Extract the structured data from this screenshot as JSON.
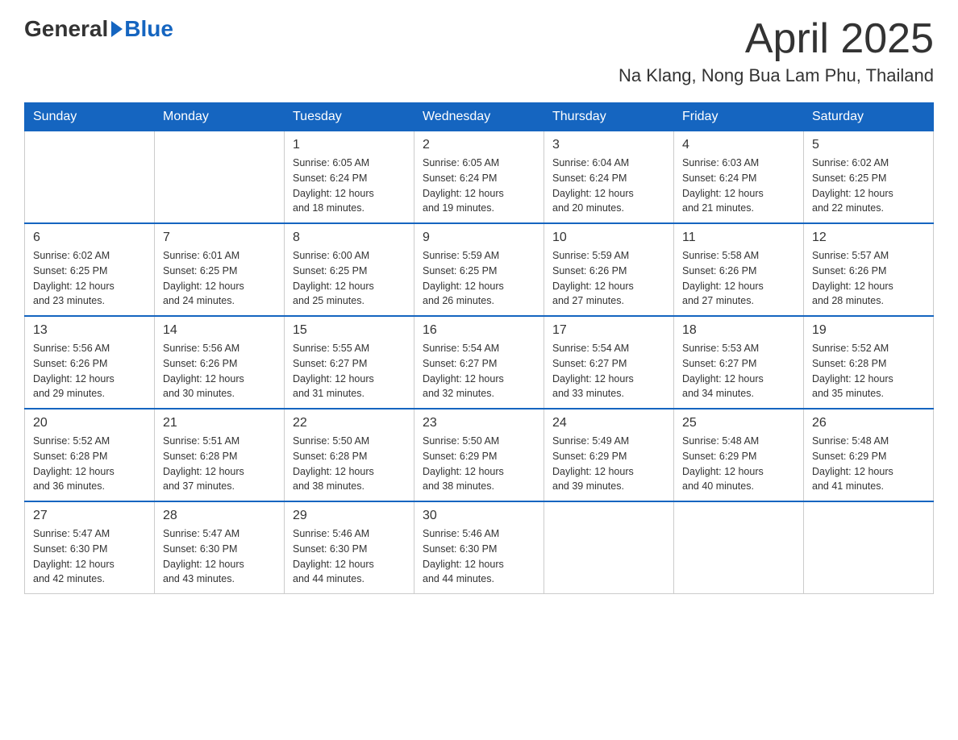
{
  "header": {
    "logo_general": "General",
    "logo_blue": "Blue",
    "title": "April 2025",
    "subtitle": "Na Klang, Nong Bua Lam Phu, Thailand"
  },
  "weekdays": [
    "Sunday",
    "Monday",
    "Tuesday",
    "Wednesday",
    "Thursday",
    "Friday",
    "Saturday"
  ],
  "weeks": [
    [
      {
        "day": "",
        "info": ""
      },
      {
        "day": "",
        "info": ""
      },
      {
        "day": "1",
        "info": "Sunrise: 6:05 AM\nSunset: 6:24 PM\nDaylight: 12 hours\nand 18 minutes."
      },
      {
        "day": "2",
        "info": "Sunrise: 6:05 AM\nSunset: 6:24 PM\nDaylight: 12 hours\nand 19 minutes."
      },
      {
        "day": "3",
        "info": "Sunrise: 6:04 AM\nSunset: 6:24 PM\nDaylight: 12 hours\nand 20 minutes."
      },
      {
        "day": "4",
        "info": "Sunrise: 6:03 AM\nSunset: 6:24 PM\nDaylight: 12 hours\nand 21 minutes."
      },
      {
        "day": "5",
        "info": "Sunrise: 6:02 AM\nSunset: 6:25 PM\nDaylight: 12 hours\nand 22 minutes."
      }
    ],
    [
      {
        "day": "6",
        "info": "Sunrise: 6:02 AM\nSunset: 6:25 PM\nDaylight: 12 hours\nand 23 minutes."
      },
      {
        "day": "7",
        "info": "Sunrise: 6:01 AM\nSunset: 6:25 PM\nDaylight: 12 hours\nand 24 minutes."
      },
      {
        "day": "8",
        "info": "Sunrise: 6:00 AM\nSunset: 6:25 PM\nDaylight: 12 hours\nand 25 minutes."
      },
      {
        "day": "9",
        "info": "Sunrise: 5:59 AM\nSunset: 6:25 PM\nDaylight: 12 hours\nand 26 minutes."
      },
      {
        "day": "10",
        "info": "Sunrise: 5:59 AM\nSunset: 6:26 PM\nDaylight: 12 hours\nand 27 minutes."
      },
      {
        "day": "11",
        "info": "Sunrise: 5:58 AM\nSunset: 6:26 PM\nDaylight: 12 hours\nand 27 minutes."
      },
      {
        "day": "12",
        "info": "Sunrise: 5:57 AM\nSunset: 6:26 PM\nDaylight: 12 hours\nand 28 minutes."
      }
    ],
    [
      {
        "day": "13",
        "info": "Sunrise: 5:56 AM\nSunset: 6:26 PM\nDaylight: 12 hours\nand 29 minutes."
      },
      {
        "day": "14",
        "info": "Sunrise: 5:56 AM\nSunset: 6:26 PM\nDaylight: 12 hours\nand 30 minutes."
      },
      {
        "day": "15",
        "info": "Sunrise: 5:55 AM\nSunset: 6:27 PM\nDaylight: 12 hours\nand 31 minutes."
      },
      {
        "day": "16",
        "info": "Sunrise: 5:54 AM\nSunset: 6:27 PM\nDaylight: 12 hours\nand 32 minutes."
      },
      {
        "day": "17",
        "info": "Sunrise: 5:54 AM\nSunset: 6:27 PM\nDaylight: 12 hours\nand 33 minutes."
      },
      {
        "day": "18",
        "info": "Sunrise: 5:53 AM\nSunset: 6:27 PM\nDaylight: 12 hours\nand 34 minutes."
      },
      {
        "day": "19",
        "info": "Sunrise: 5:52 AM\nSunset: 6:28 PM\nDaylight: 12 hours\nand 35 minutes."
      }
    ],
    [
      {
        "day": "20",
        "info": "Sunrise: 5:52 AM\nSunset: 6:28 PM\nDaylight: 12 hours\nand 36 minutes."
      },
      {
        "day": "21",
        "info": "Sunrise: 5:51 AM\nSunset: 6:28 PM\nDaylight: 12 hours\nand 37 minutes."
      },
      {
        "day": "22",
        "info": "Sunrise: 5:50 AM\nSunset: 6:28 PM\nDaylight: 12 hours\nand 38 minutes."
      },
      {
        "day": "23",
        "info": "Sunrise: 5:50 AM\nSunset: 6:29 PM\nDaylight: 12 hours\nand 38 minutes."
      },
      {
        "day": "24",
        "info": "Sunrise: 5:49 AM\nSunset: 6:29 PM\nDaylight: 12 hours\nand 39 minutes."
      },
      {
        "day": "25",
        "info": "Sunrise: 5:48 AM\nSunset: 6:29 PM\nDaylight: 12 hours\nand 40 minutes."
      },
      {
        "day": "26",
        "info": "Sunrise: 5:48 AM\nSunset: 6:29 PM\nDaylight: 12 hours\nand 41 minutes."
      }
    ],
    [
      {
        "day": "27",
        "info": "Sunrise: 5:47 AM\nSunset: 6:30 PM\nDaylight: 12 hours\nand 42 minutes."
      },
      {
        "day": "28",
        "info": "Sunrise: 5:47 AM\nSunset: 6:30 PM\nDaylight: 12 hours\nand 43 minutes."
      },
      {
        "day": "29",
        "info": "Sunrise: 5:46 AM\nSunset: 6:30 PM\nDaylight: 12 hours\nand 44 minutes."
      },
      {
        "day": "30",
        "info": "Sunrise: 5:46 AM\nSunset: 6:30 PM\nDaylight: 12 hours\nand 44 minutes."
      },
      {
        "day": "",
        "info": ""
      },
      {
        "day": "",
        "info": ""
      },
      {
        "day": "",
        "info": ""
      }
    ]
  ]
}
